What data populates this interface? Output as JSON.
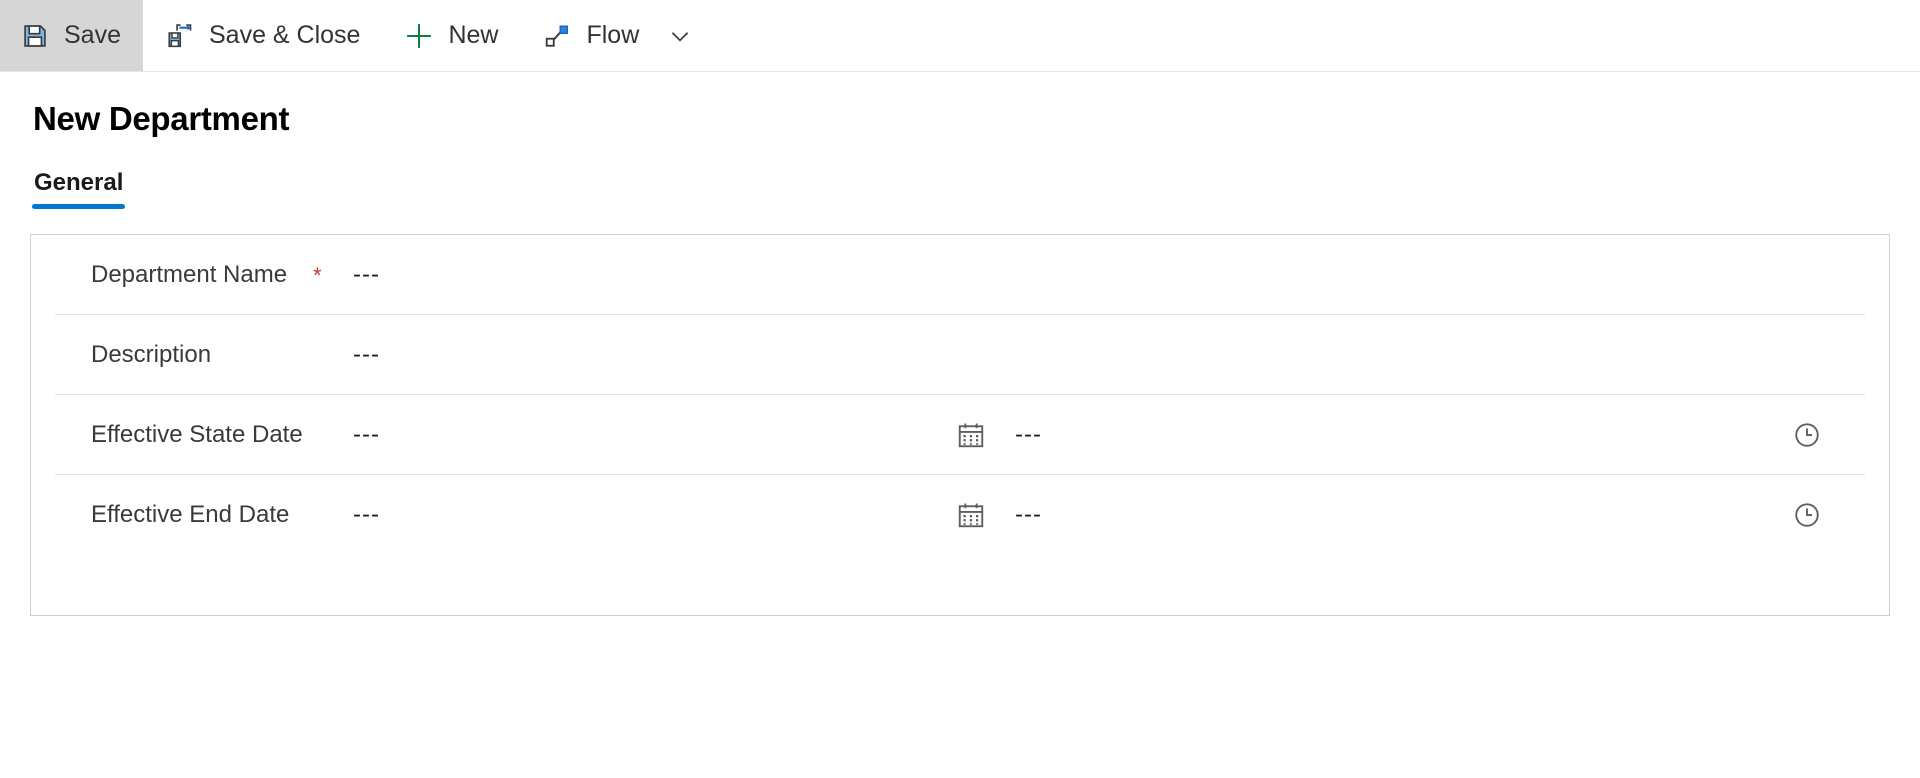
{
  "command_bar": {
    "buttons": [
      {
        "label": "Save",
        "icon": "save-floppy-icon",
        "active": true
      },
      {
        "label": "Save & Close",
        "icon": "save-and-close-icon",
        "active": false
      },
      {
        "label": "New",
        "icon": "plus-icon",
        "active": false
      },
      {
        "label": "Flow",
        "icon": "flow-icon",
        "active": false
      }
    ],
    "overflow_icon": "chevron-down-icon"
  },
  "page": {
    "title": "New Department"
  },
  "tabs": [
    {
      "label": "General",
      "selected": true
    }
  ],
  "form": {
    "empty_value": "---",
    "required_marker": "*",
    "rows": [
      {
        "label": "Department Name",
        "required": true,
        "value": "---",
        "has_date_picker": false,
        "has_time_picker": false
      },
      {
        "label": "Description",
        "required": false,
        "value": "---",
        "has_date_picker": false,
        "has_time_picker": false
      },
      {
        "label": "Effective State Date",
        "required": false,
        "value": "---",
        "has_date_picker": true,
        "date_icon": "calendar-icon",
        "time_value": "---",
        "has_time_picker": true,
        "time_icon": "clock-icon"
      },
      {
        "label": "Effective End Date",
        "required": false,
        "value": "---",
        "has_date_picker": true,
        "date_icon": "calendar-icon",
        "time_value": "---",
        "has_time_picker": true,
        "time_icon": "clock-icon"
      }
    ]
  },
  "colors": {
    "accent": "#0078d4",
    "required": "#d13438",
    "new_icon": "#107c41",
    "active_button_bg": "#d6d6d6",
    "card_border": "#d1d1d1",
    "row_divider": "#e1e1e1"
  }
}
